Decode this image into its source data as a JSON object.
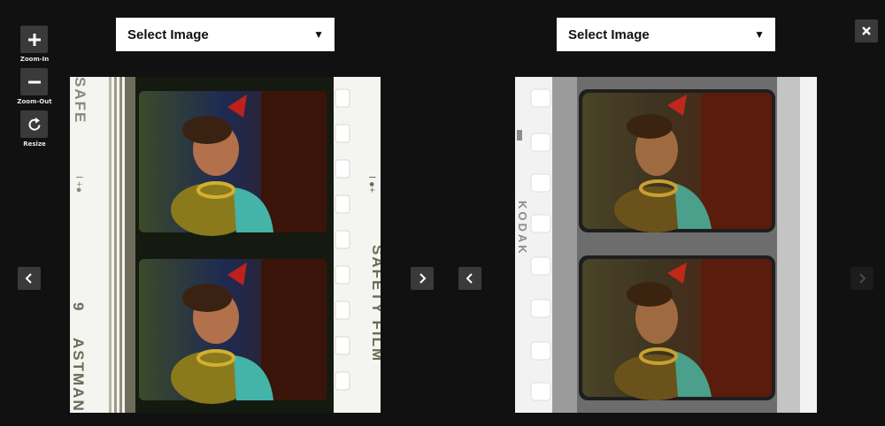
{
  "toolbar": {
    "zoom_in_label": "Zoom-In",
    "zoom_out_label": "Zoom-Out",
    "resize_label": "Resize"
  },
  "left_viewer": {
    "select_label": "Select Image",
    "filmstrip_text": {
      "edge_right_main": "SAFETY FILM",
      "edge_right_mark": "I ●+",
      "edge_left_top": "SAFE",
      "edge_left_mark": "I +●",
      "edge_left_number": "9",
      "edge_left_bottom": "ASTMAN"
    }
  },
  "right_viewer": {
    "select_label": "Select Image",
    "filmstrip_text": {
      "edge_left_brand": "KODAK"
    }
  },
  "icons": {
    "zoom_in": "plus-icon",
    "zoom_out": "minus-icon",
    "resize": "rotate-icon",
    "close": "close-icon",
    "prev": "chevron-left-icon",
    "next": "chevron-right-icon",
    "dropdown": "caret-down-icon"
  },
  "colors": {
    "background": "#111111",
    "button": "#3a3a3a"
  }
}
